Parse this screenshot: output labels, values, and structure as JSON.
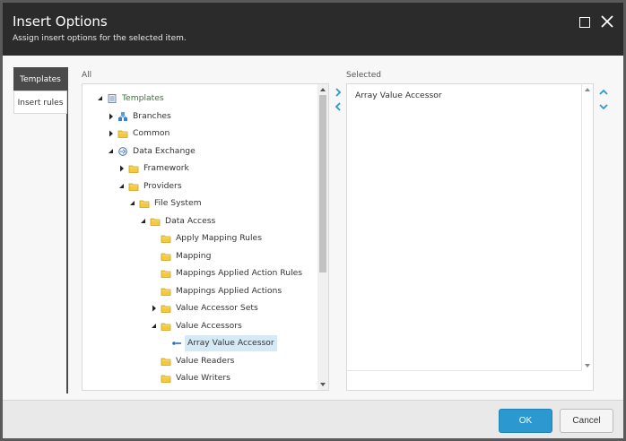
{
  "dialog": {
    "title": "Insert Options",
    "subtitle": "Assign insert options for the selected item."
  },
  "tabs": [
    {
      "label": "Templates",
      "active": true
    },
    {
      "label": "Insert rules",
      "active": false
    }
  ],
  "panels": {
    "all_label": "All",
    "selected_label": "Selected"
  },
  "tree": [
    {
      "label": "Templates",
      "icon": "templates-icon",
      "expander": "expanded",
      "color": "#2a7d2a"
    },
    {
      "label": "Branches",
      "icon": "branch-icon",
      "expander": "collapsed"
    },
    {
      "label": "Common",
      "icon": "folder-icon",
      "expander": "collapsed"
    },
    {
      "label": "Data Exchange",
      "icon": "data-exchange-icon",
      "expander": "expanded"
    },
    {
      "label": "Framework",
      "icon": "folder-icon",
      "expander": "collapsed"
    },
    {
      "label": "Providers",
      "icon": "folder-icon",
      "expander": "expanded"
    },
    {
      "label": "File System",
      "icon": "folder-icon",
      "expander": "expanded"
    },
    {
      "label": "Data Access",
      "icon": "folder-icon",
      "expander": "expanded"
    },
    {
      "label": "Apply Mapping Rules",
      "icon": "folder-icon",
      "expander": "none"
    },
    {
      "label": "Mapping",
      "icon": "folder-icon",
      "expander": "none"
    },
    {
      "label": "Mappings Applied Action Rules",
      "icon": "folder-icon",
      "expander": "none"
    },
    {
      "label": "Mappings Applied Actions",
      "icon": "folder-icon",
      "expander": "none"
    },
    {
      "label": "Value Accessor Sets",
      "icon": "folder-icon",
      "expander": "collapsed"
    },
    {
      "label": "Value Accessors",
      "icon": "folder-icon",
      "expander": "expanded"
    },
    {
      "label": "Array Value Accessor",
      "icon": "template-item-icon",
      "expander": "none",
      "selected": true
    },
    {
      "label": "Value Readers",
      "icon": "folder-icon",
      "expander": "none"
    },
    {
      "label": "Value Writers",
      "icon": "folder-icon",
      "expander": "none"
    }
  ],
  "selected_items": [
    "Array Value Accessor"
  ],
  "buttons": {
    "ok": "OK",
    "cancel": "Cancel"
  },
  "colors": {
    "header_bg": "#2b2b2b",
    "ok_bg": "#2b98d0",
    "accent": "#2b98d0",
    "folder": "#f5c93a"
  }
}
